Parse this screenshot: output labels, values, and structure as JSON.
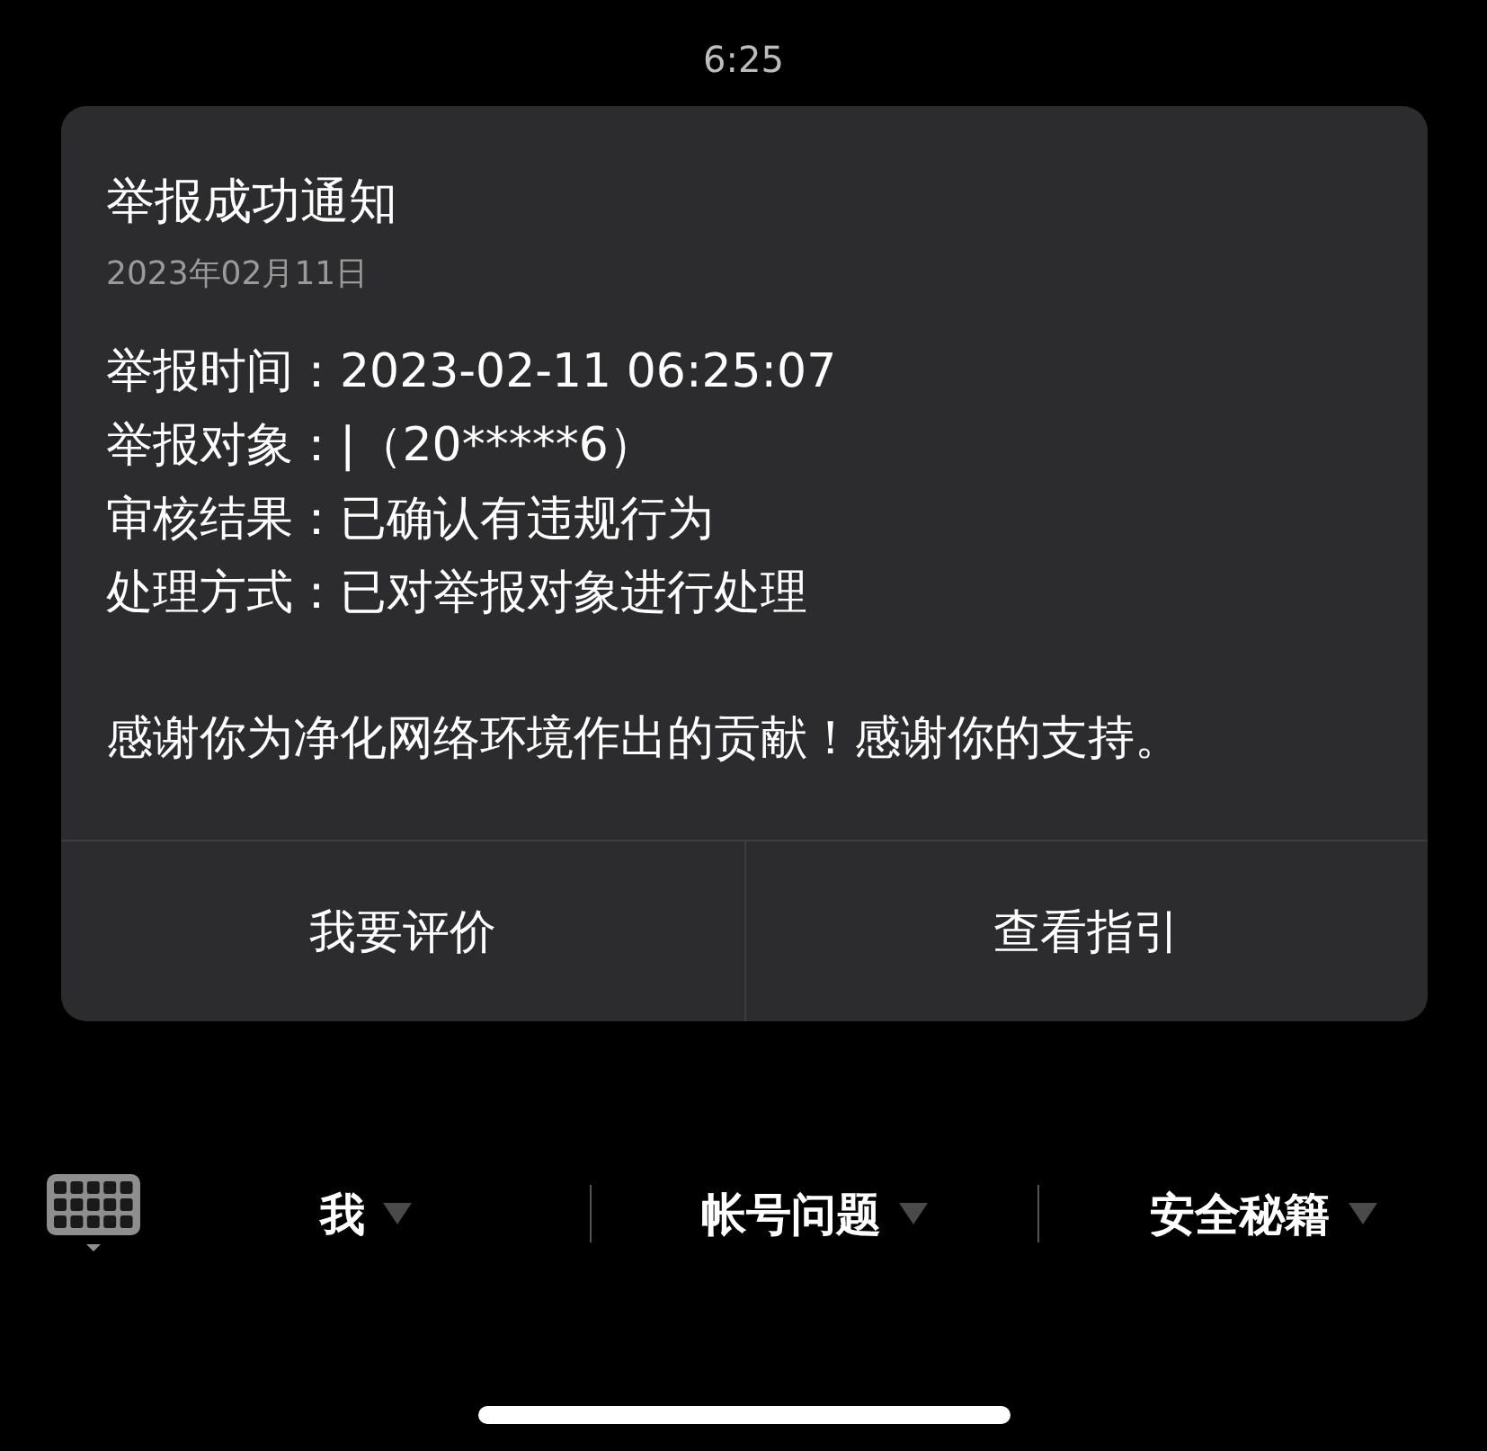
{
  "status_bar": {
    "time": "6:25"
  },
  "card": {
    "title": "举报成功通知",
    "date": "2023年02月11日",
    "details": [
      {
        "label": "举报时间：",
        "value": "2023-02-11 06:25:07"
      },
      {
        "label": "举报对象：",
        "value": "|（20*****6）"
      },
      {
        "label": "审核结果：",
        "value": "已确认有违规行为"
      },
      {
        "label": "处理方式：",
        "value": "已对举报对象进行处理"
      }
    ],
    "message": "感谢你为净化网络环境作出的贡献！感谢你的支持。",
    "buttons": [
      "我要评价",
      "查看指引"
    ]
  },
  "menu_bar": {
    "items": [
      {
        "label": "我"
      },
      {
        "label": "帐号问题"
      },
      {
        "label": "安全秘籍"
      }
    ]
  }
}
